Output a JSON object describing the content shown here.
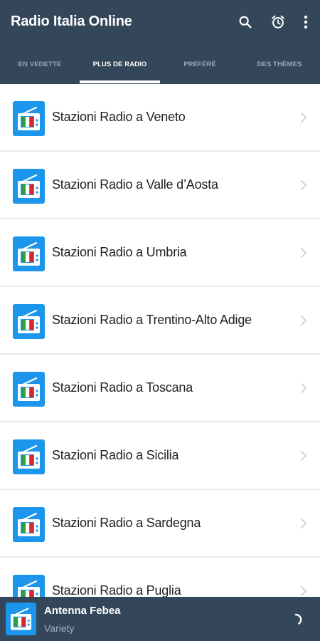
{
  "appbar": {
    "title": "Radio Italia Online",
    "actions": [
      "search-icon",
      "alarm-icon",
      "more-vert-icon"
    ],
    "background_color": "#34465a"
  },
  "tabs": [
    {
      "label": "EN VEDETTE",
      "active": false
    },
    {
      "label": "PLUS DE RADIO",
      "active": true
    },
    {
      "label": "PRÉFÉRÉ",
      "active": false
    },
    {
      "label": "DES THÈMES",
      "active": false
    }
  ],
  "list": {
    "item_icon": "radio-icon",
    "item_icon_color": "#1b96ec",
    "trailing_icon": "chevron-right-icon",
    "items": [
      {
        "label": "Stazioni Radio a Veneto"
      },
      {
        "label": "Stazioni Radio a Valle d’Aosta"
      },
      {
        "label": "Stazioni Radio a Umbria"
      },
      {
        "label": "Stazioni Radio a Trentino-Alto Adige"
      },
      {
        "label": "Stazioni Radio a Toscana"
      },
      {
        "label": "Stazioni Radio a Sicilia"
      },
      {
        "label": "Stazioni Radio a Sardegna"
      },
      {
        "label": "Stazioni Radio a Puglia"
      }
    ]
  },
  "player": {
    "title": "Antenna Febea",
    "subtitle": "Variety",
    "icon": "radio-icon",
    "status_icon": "loading-spinner-icon"
  }
}
